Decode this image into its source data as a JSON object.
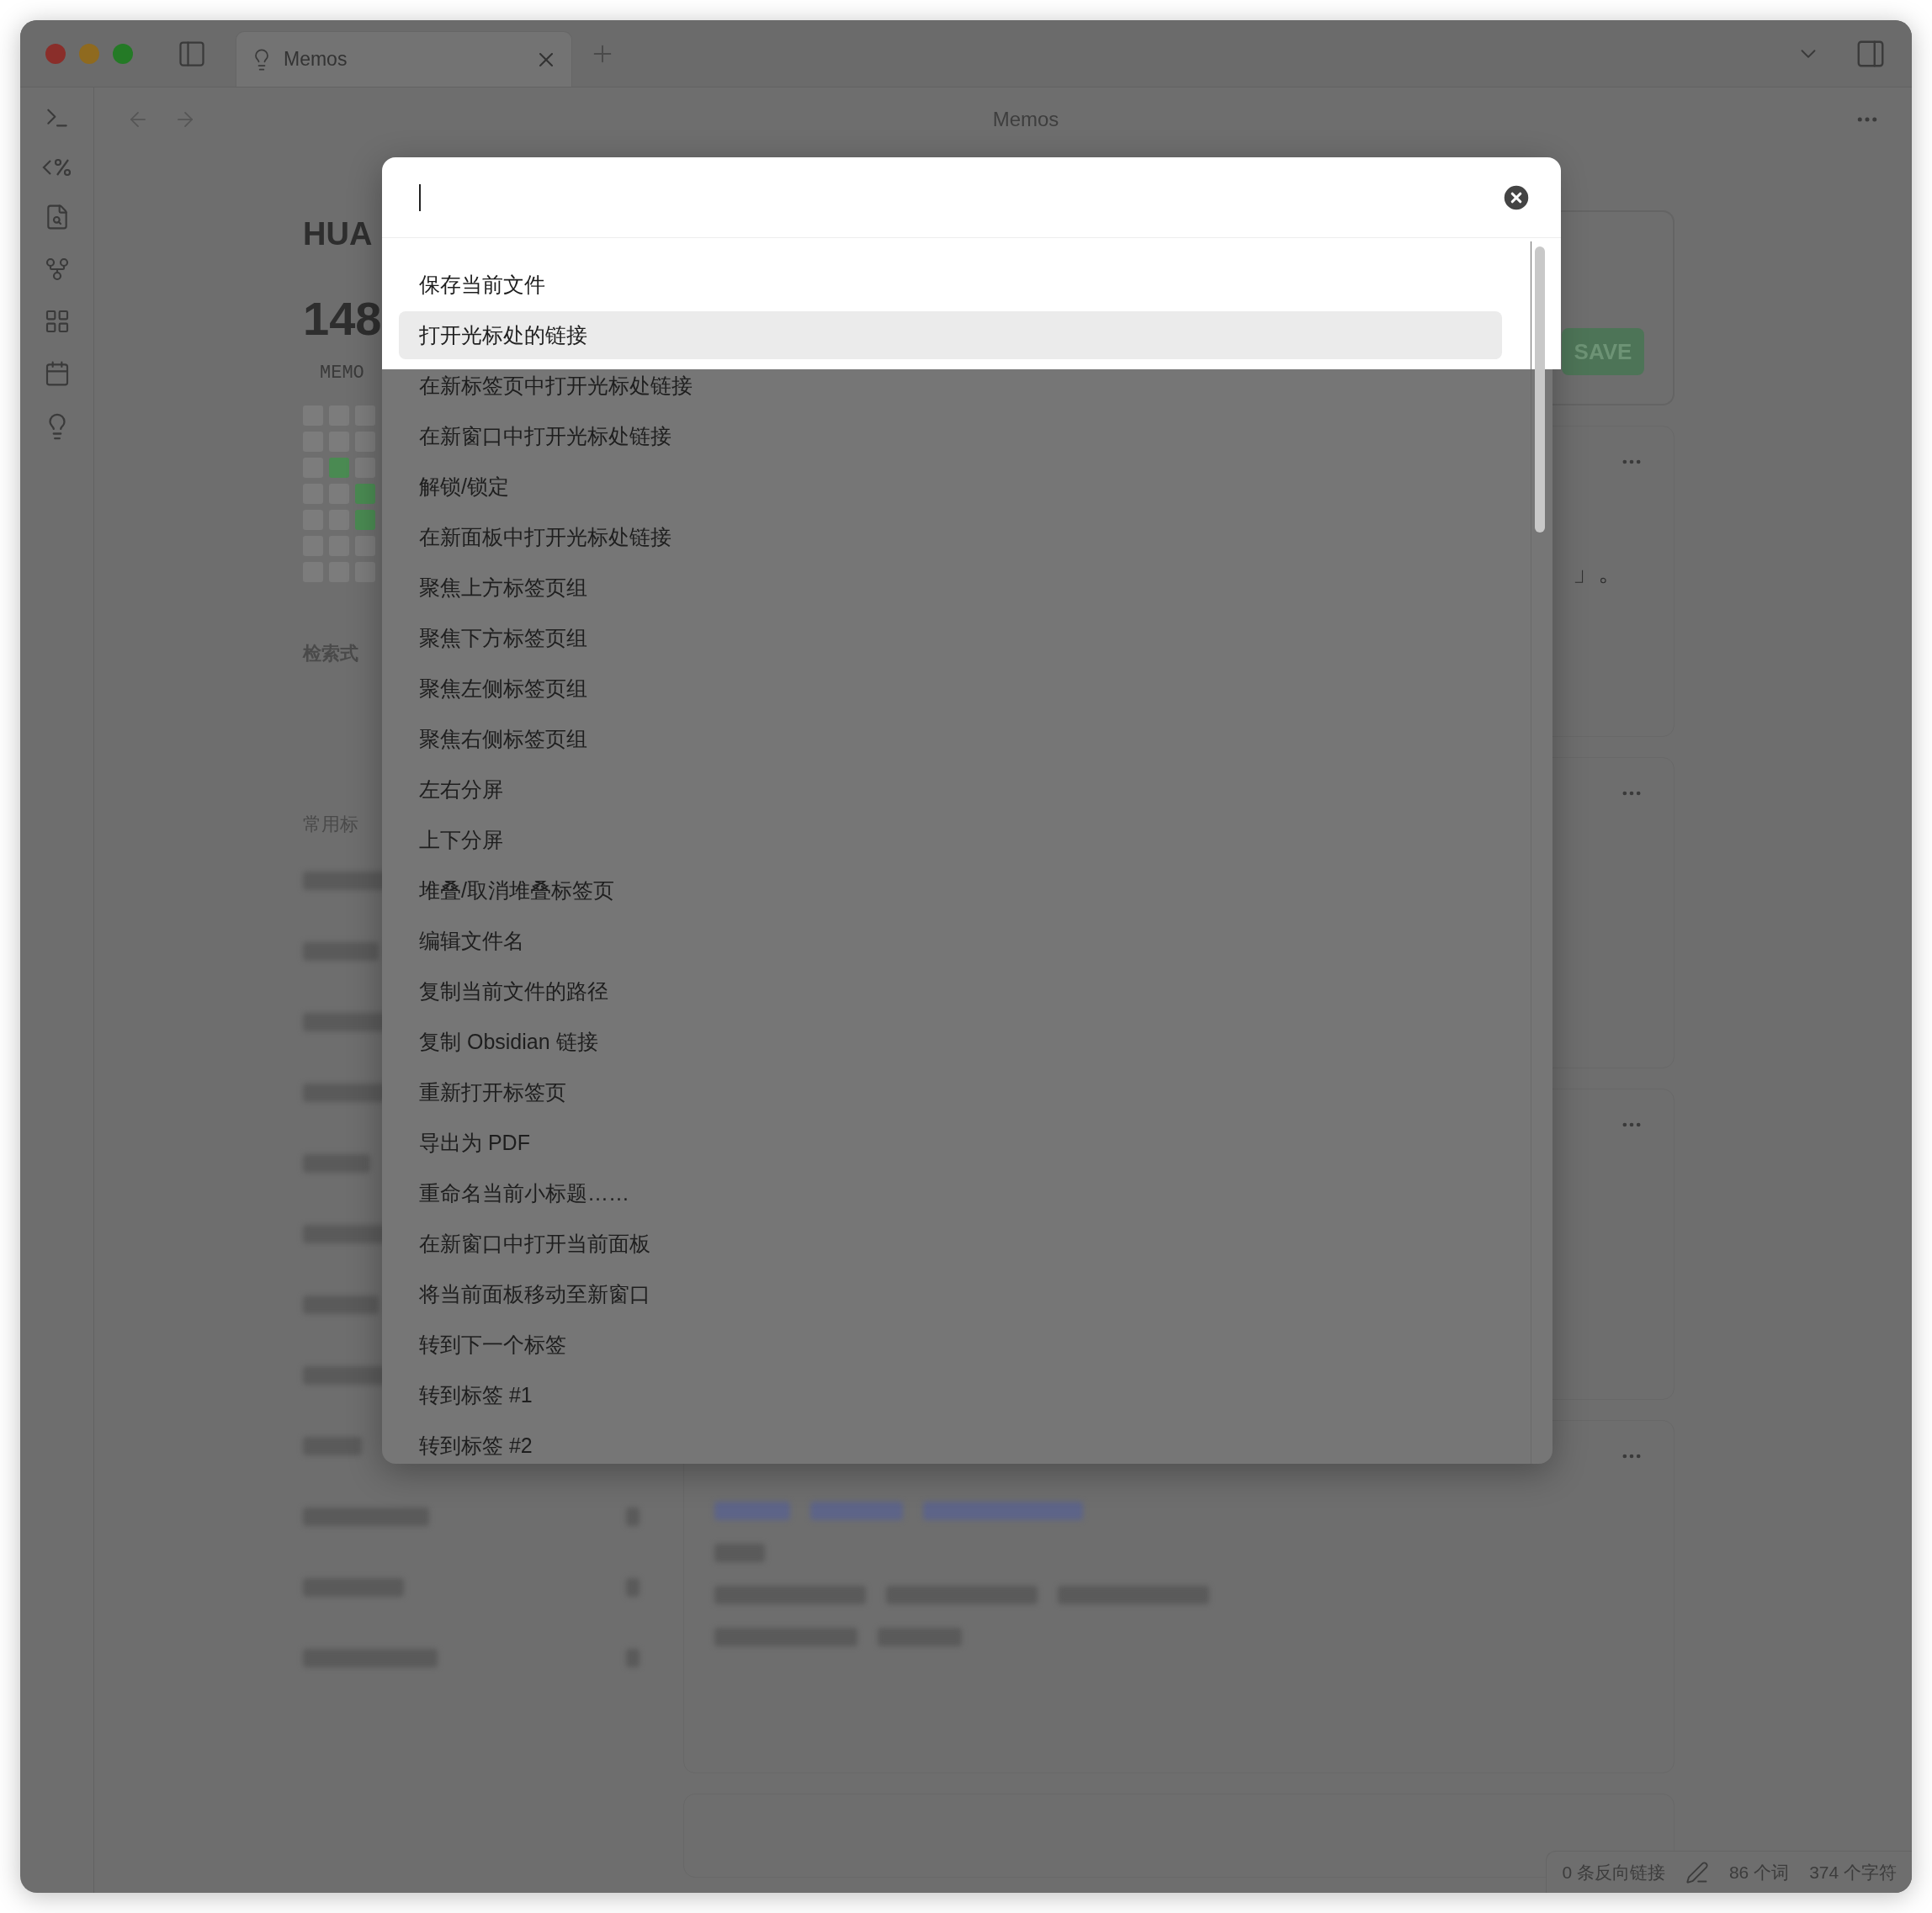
{
  "window": {
    "tab": {
      "title": "Memos"
    },
    "header_title": "Memos"
  },
  "memos": {
    "title": "HUA",
    "count": "148",
    "count_label": "MEMO",
    "heatmap": [
      [
        {
          "filled": false
        },
        {
          "filled": false
        },
        {
          "filled": false
        }
      ],
      [
        {
          "filled": false
        },
        {
          "filled": false
        },
        {
          "filled": false
        }
      ],
      [
        {
          "filled": false
        },
        {
          "filled": true
        },
        {
          "filled": false
        }
      ],
      [
        {
          "filled": false
        },
        {
          "filled": false
        },
        {
          "filled": true
        }
      ],
      [
        {
          "filled": false
        },
        {
          "filled": false
        },
        {
          "filled": true
        }
      ],
      [
        {
          "filled": false
        },
        {
          "filled": false
        },
        {
          "filled": false
        }
      ],
      [
        {
          "filled": false
        },
        {
          "filled": false
        },
        {
          "filled": false
        }
      ]
    ],
    "search_label": "检索式",
    "tags_label": "常用标"
  },
  "editor": {
    "button": "SAVE"
  },
  "cards": [
    {
      "snippet": "」。"
    }
  ],
  "palette": {
    "items": [
      {
        "label": "保存当前文件",
        "selected": false
      },
      {
        "label": "打开光标处的链接",
        "selected": true
      },
      {
        "label": "在新标签页中打开光标处链接",
        "selected": false
      },
      {
        "label": "在新窗口中打开光标处链接",
        "selected": false
      },
      {
        "label": "解锁/锁定",
        "selected": false
      },
      {
        "label": "在新面板中打开光标处链接",
        "selected": false
      },
      {
        "label": "聚焦上方标签页组",
        "selected": false
      },
      {
        "label": "聚焦下方标签页组",
        "selected": false
      },
      {
        "label": "聚焦左侧标签页组",
        "selected": false
      },
      {
        "label": "聚焦右侧标签页组",
        "selected": false
      },
      {
        "label": "左右分屏",
        "selected": false
      },
      {
        "label": "上下分屏",
        "selected": false
      },
      {
        "label": "堆叠/取消堆叠标签页",
        "selected": false
      },
      {
        "label": "编辑文件名",
        "selected": false
      },
      {
        "label": "复制当前文件的路径",
        "selected": false
      },
      {
        "label": "复制 Obsidian 链接",
        "selected": false
      },
      {
        "label": "重新打开标签页",
        "selected": false
      },
      {
        "label": "导出为 PDF",
        "selected": false
      },
      {
        "label": "重命名当前小标题……",
        "selected": false
      },
      {
        "label": "在新窗口中打开当前面板",
        "selected": false
      },
      {
        "label": "将当前面板移动至新窗口",
        "selected": false
      },
      {
        "label": "转到下一个标签",
        "selected": false
      },
      {
        "label": "转到标签 #1",
        "selected": false
      },
      {
        "label": "转到标签 #2",
        "selected": false
      }
    ]
  },
  "status_bar": {
    "backlinks": "0 条反向链接",
    "words": "86 个词",
    "chars": "374 个字符"
  }
}
